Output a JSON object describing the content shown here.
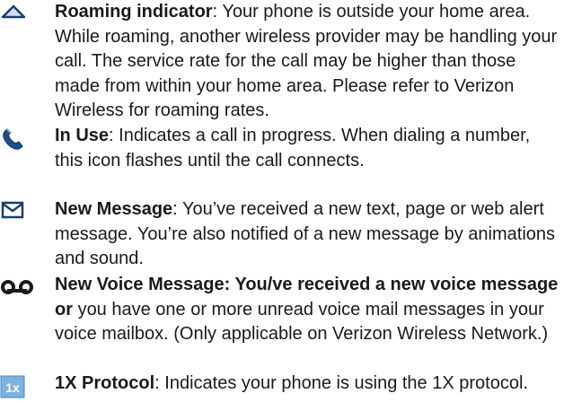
{
  "entries": [
    {
      "icon": "roaming-triangle-icon",
      "term": "Roaming indicator",
      "sep": ": ",
      "description": "Your phone is outside your home area. While roaming, another wireless provider may be handling your call. The service rate for the call may be higher than those made from within your home area. Please refer to Verizon Wireless for roaming rates."
    },
    {
      "icon": "phone-handset-icon",
      "term": "In Use",
      "sep": ": ",
      "description": "Indicates a call in progress. When dialing a number, this icon flashes until the call connects."
    },
    {
      "icon": "envelope-icon",
      "term": "New Message",
      "sep": ": ",
      "description": "You’ve received a new text, page or web alert message. You’re also notified of a new message by animations and sound."
    },
    {
      "icon": "voicemail-icon",
      "term": "New Voice Message: You/ve received a new voice message or",
      "sep": " ",
      "description": "you have one or more unread voice mail messages in your voice mailbox. (Only applicable on Verizon Wireless Network.)"
    },
    {
      "icon": "1x-protocol-icon",
      "icon_text": "1x",
      "term": "1X Protocol",
      "sep": ": ",
      "description": "Indicates your phone is using the 1X protocol."
    }
  ],
  "colors": {
    "icon_blue": "#2f5f9e",
    "icon_dark": "#1a3f6f",
    "icon_light": "#cfe0f2",
    "badge_bg": "#7fb2e0",
    "text": "#1a1a1a"
  }
}
